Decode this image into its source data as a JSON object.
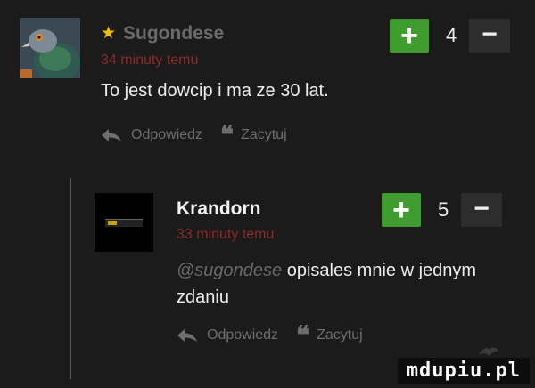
{
  "comments": [
    {
      "author": "Sugondese",
      "featured_icon": "star-icon",
      "time": "34 minuty temu",
      "body": "To jest dowcip i ma ze 30 lat.",
      "score": "4",
      "plus_label": "+",
      "minus_label": "−",
      "reply_label": "Odpowiedz",
      "quote_label": "Zacytuj"
    },
    {
      "author": "Krandorn",
      "time": "33 minuty temu",
      "mention": "@sugondese",
      "body": "opisales mnie w jednym zdaniu",
      "score": "5",
      "plus_label": "+",
      "minus_label": "−",
      "reply_label": "Odpowiedz",
      "quote_label": "Zacytuj"
    }
  ],
  "watermark": "mdupiu.pl",
  "colors": {
    "background": "#1b1b1b",
    "plus_button": "#3e9d2e",
    "minus_button": "#2d2d2d",
    "time_text": "#8b2a2a",
    "star": "#f0c000"
  },
  "icons": [
    "star-icon",
    "reply-arrow-icon",
    "quote-icon"
  ]
}
